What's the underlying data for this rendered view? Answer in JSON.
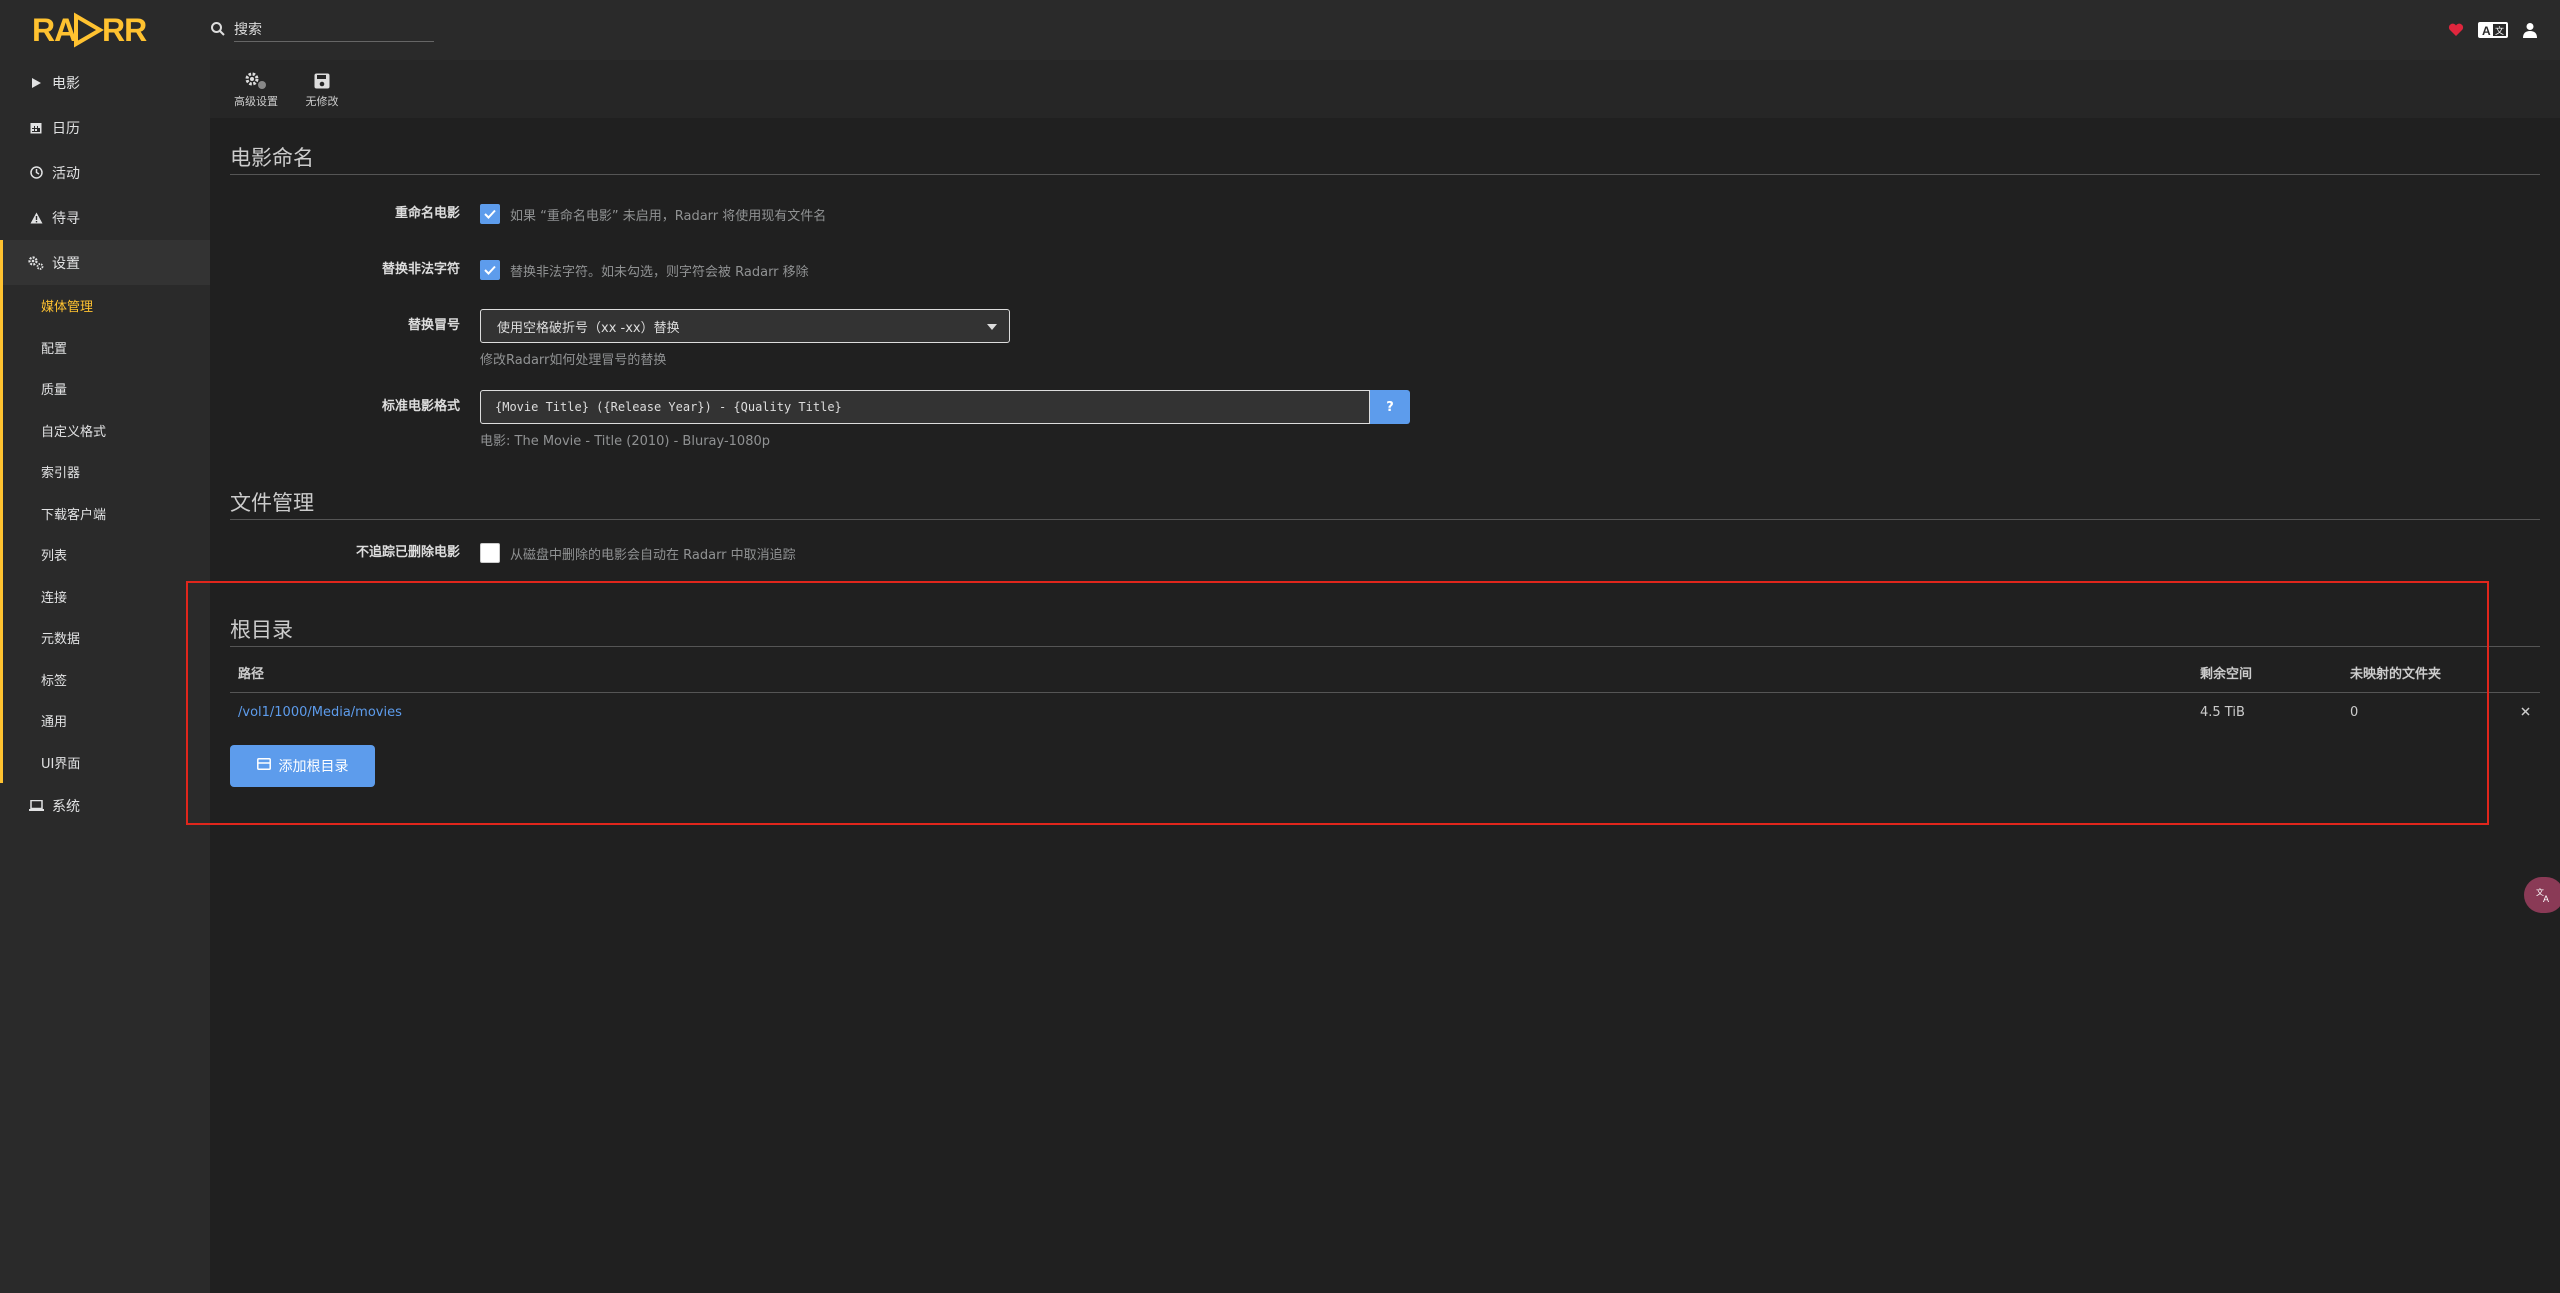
{
  "app": {
    "name": "RADARR",
    "brand_color": "#ffc230",
    "accent_color": "#5d9cec"
  },
  "search": {
    "placeholder": "搜索"
  },
  "header_icons": [
    "heart-icon",
    "translate-icon",
    "user-icon"
  ],
  "sidebar": {
    "items": [
      {
        "label": "电影",
        "icon": "play-icon"
      },
      {
        "label": "日历",
        "icon": "calendar-icon"
      },
      {
        "label": "活动",
        "icon": "clock-icon"
      },
      {
        "label": "待寻",
        "icon": "warning-icon"
      },
      {
        "label": "设置",
        "icon": "cogs-icon"
      }
    ],
    "settings_sub": [
      {
        "label": "媒体管理",
        "active": true
      },
      {
        "label": "配置"
      },
      {
        "label": "质量"
      },
      {
        "label": "自定义格式"
      },
      {
        "label": "索引器"
      },
      {
        "label": "下载客户端"
      },
      {
        "label": "列表"
      },
      {
        "label": "连接"
      },
      {
        "label": "元数据"
      },
      {
        "label": "标签"
      },
      {
        "label": "通用"
      },
      {
        "label": "UI界面"
      }
    ],
    "system": {
      "label": "系统",
      "icon": "laptop-icon"
    }
  },
  "toolbar": {
    "advanced_label": "高级设置",
    "save_label": "无修改"
  },
  "movie_naming": {
    "title": "电影命名",
    "rename_label": "重命名电影",
    "rename_help": "如果 “重命名电影” 未启用，Radarr 将使用现有文件名",
    "rename_checked": true,
    "illegal_label": "替换非法字符",
    "illegal_help": "替换非法字符。如未勾选，则字符会被 Radarr 移除",
    "illegal_checked": true,
    "colon_label": "替换冒号",
    "colon_value": "使用空格破折号（xx -xx）替换",
    "colon_help": "修改Radarr如何处理冒号的替换",
    "format_label": "标准电影格式",
    "format_value": "{Movie Title} ({Release Year}) - {Quality Title}",
    "format_help_btn": "?",
    "format_example": "电影: The Movie - Title (2010) - Bluray-1080p"
  },
  "file_management": {
    "title": "文件管理",
    "unmonitor_label": "不追踪已删除电影",
    "unmonitor_help": "从磁盘中删除的电影会自动在 Radarr 中取消追踪",
    "unmonitor_checked": false
  },
  "root_folders": {
    "title": "根目录",
    "columns": {
      "path": "路径",
      "free": "剩余空间",
      "unmapped": "未映射的文件夹"
    },
    "rows": [
      {
        "path": "/vol1/1000/Media/movies",
        "free": "4.5 TiB",
        "unmapped": "0"
      }
    ],
    "add_label": "添加根目录"
  }
}
